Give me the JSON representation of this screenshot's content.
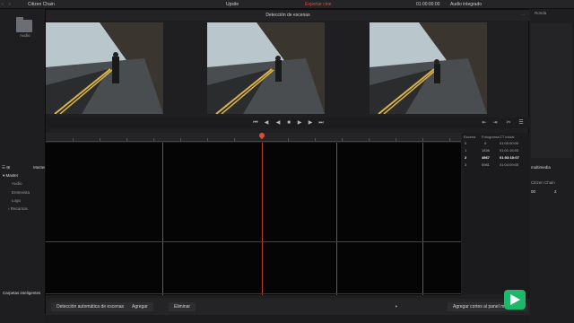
{
  "app": {
    "project_name": "Citizen Chain",
    "window_title": "Upsite",
    "status_tag": "Exportar cine",
    "timecode": "01:00:00:00",
    "audio_label": "Audio integrado"
  },
  "media_pool": {
    "bin_label": "Audio",
    "master_header": "Master",
    "bins": [
      "Master",
      "Audio",
      "Entrevista",
      "Logo",
      "Recursos"
    ],
    "smart_bins": "Carpetas inteligentes",
    "right_header": "multimedia",
    "right_fields": [
      "Ronda",
      "Citizen Chain",
      "00",
      "2"
    ]
  },
  "dialog": {
    "title": "Detección de escenas",
    "frames": [
      "frame-1",
      "frame-2",
      "frame-3"
    ],
    "transport": [
      "⏮",
      "◀",
      "◀",
      "■",
      "▶",
      "▶",
      "⏭"
    ],
    "table_headers": [
      "Escena",
      "Fotograma",
      "CT inicial"
    ],
    "table_rows": [
      {
        "scene": "0",
        "frame": "0",
        "tc": "01:00:00:00",
        "selected": false
      },
      {
        "scene": "1",
        "frame": "1836",
        "tc": "01:01:16:03",
        "selected": false
      },
      {
        "scene": "2",
        "frame": "4567",
        "tc": "01:03:10:07",
        "selected": true
      },
      {
        "scene": "3",
        "frame": "5981",
        "tc": "01:04:09:05",
        "selected": false
      }
    ],
    "buttons": {
      "auto": "Detección automática de escenas",
      "add": "Agregar",
      "delete": "Eliminar",
      "cut_to_pool": "Agregar cortes al panel multimedia"
    }
  },
  "colors": {
    "playhead": "#e04a3a",
    "green_line": "#2f7a3b",
    "red_line": "#7a2d2d",
    "accent_green": "#1fb86a"
  }
}
